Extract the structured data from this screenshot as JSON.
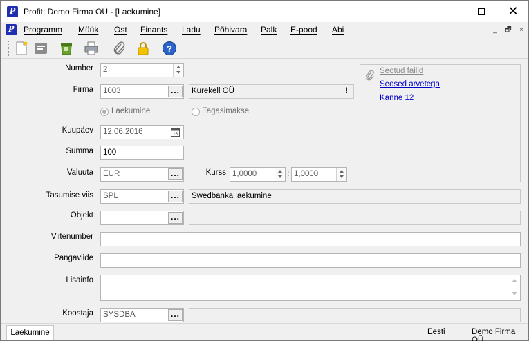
{
  "window": {
    "title": "Profit: Demo Firma OÜ - [Laekumine]",
    "logo_letter": "P"
  },
  "menu": {
    "items": [
      "Programm",
      "Müük",
      "Ost",
      "Finants",
      "Ladu",
      "Põhivara",
      "Palk",
      "E-pood",
      "Abi"
    ],
    "mdi": [
      "_",
      "🗗",
      "×"
    ]
  },
  "toolbar": {
    "buttons": [
      "new-document-icon",
      "notes-icon",
      "delete-bin-icon",
      "print-icon",
      "attachment-icon",
      "lock-icon",
      "help-icon"
    ]
  },
  "form": {
    "number": {
      "label": "Number",
      "value": "2"
    },
    "firma": {
      "label": "Firma",
      "code": "1003",
      "name": "Kurekell OÜ",
      "flag": "!"
    },
    "radios": {
      "laekumine": "Laekumine",
      "tagasimakse": "Tagasimakse",
      "selected": "Laekumine"
    },
    "kuupaev": {
      "label": "Kuupäev",
      "value": "12.06.2016"
    },
    "summa": {
      "label": "Summa",
      "value": "100"
    },
    "valuuta": {
      "label": "Valuuta",
      "value": "EUR"
    },
    "kurss": {
      "label": "Kurss",
      "value1": "1,0000",
      "separator": ":",
      "value2": "1,0000"
    },
    "tasumise_viis": {
      "label": "Tasumise viis",
      "code": "SPL",
      "name": "Swedbanka laekumine"
    },
    "objekt": {
      "label": "Objekt",
      "value": "",
      "name": ""
    },
    "viitenumber": {
      "label": "Viitenumber",
      "value": ""
    },
    "pangaviide": {
      "label": "Pangaviide",
      "value": ""
    },
    "lisainfo": {
      "label": "Lisainfo",
      "value": ""
    },
    "koostaja": {
      "label": "Koostaja",
      "value": "SYSDBA",
      "name": ""
    },
    "dots": "..."
  },
  "links": {
    "seotud_failid": "Seotud failid",
    "seosed_arvetega": "Seosed arvetega",
    "kanne": "Kanne 12"
  },
  "status": {
    "tab": "Laekumine",
    "language": "Eesti",
    "company": "Demo Firma OÜ"
  }
}
